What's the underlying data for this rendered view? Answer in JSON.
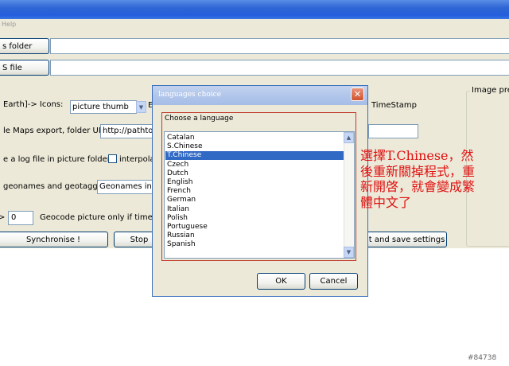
{
  "menu": {
    "help": "Help"
  },
  "toolbar": {
    "photos_folder": "s folder",
    "file_btn": "S file"
  },
  "labels": {
    "earth_icons": "Earth]->   Icons:",
    "icons_select": "picture thumb",
    "e_label": "E",
    "timestamp": "TimeStamp",
    "image_preview": "Image prev",
    "maps_export": "le Maps export, folder URL=",
    "maps_url": "http://pathtot",
    "log_file": "e a log file in picture folder",
    "interpolate": "interpolat",
    "geonames": "geonames and geotagged",
    "geonames_select": "Geonames in EX",
    "geocode_value": "0",
    "geocode": "Geocode picture only if time diff"
  },
  "buttons": {
    "synchronise": "Synchronise !",
    "stop": "Stop",
    "quit_save": "uit and save settings"
  },
  "dialog": {
    "title": "languages choice",
    "close": "✕",
    "group_label": "Choose a language",
    "languages": [
      "Catalan",
      "S.Chinese",
      "T.Chinese",
      "Czech",
      "Dutch",
      "English",
      "French",
      "German",
      "Italian",
      "Polish",
      "Portuguese",
      "Russian",
      "Spanish"
    ],
    "selected": "T.Chinese",
    "ok": "OK",
    "cancel": "Cancel"
  },
  "annotation": {
    "lines": [
      "選擇T.Chinese，然",
      "後重新關掉程式，重",
      "新開啓，就會變成繁",
      "體中文了"
    ],
    "color": "#e01010"
  },
  "watermark": "#84738",
  "colors": {
    "titlebar": "#245edb",
    "window_bg": "#ece9d8",
    "selection": "#316ac5"
  }
}
